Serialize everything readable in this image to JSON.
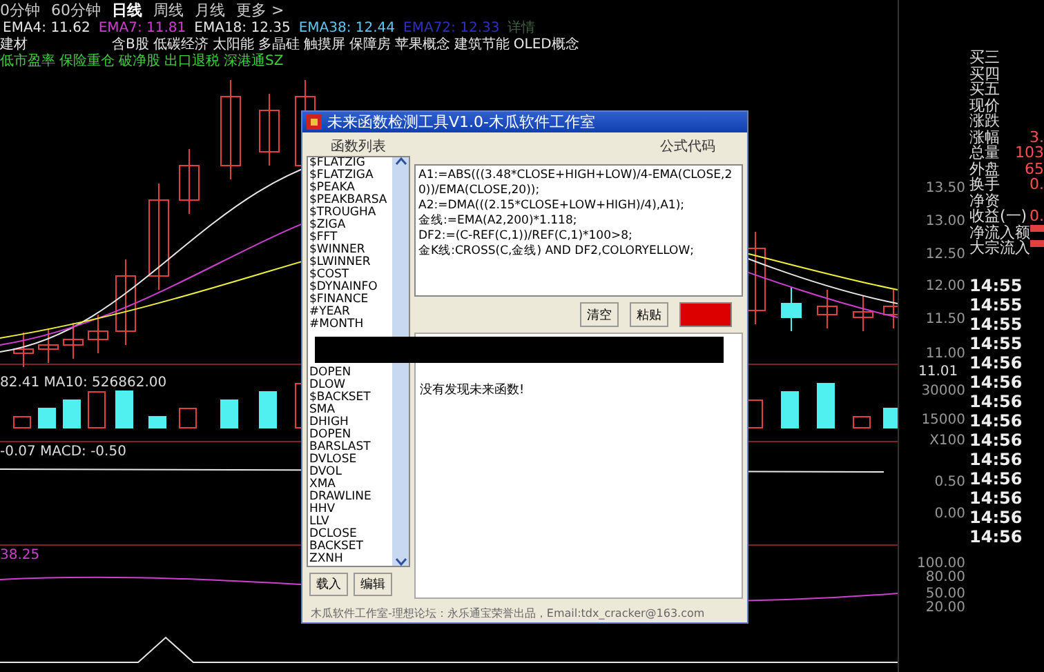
{
  "period_tabs": [
    {
      "label": "0分钟",
      "selected": false
    },
    {
      "label": "60分钟",
      "selected": false
    },
    {
      "label": "日线",
      "selected": true
    },
    {
      "label": "周线",
      "selected": false
    },
    {
      "label": "月线",
      "selected": false
    },
    {
      "label": "更多 >",
      "selected": false
    }
  ],
  "indicators": [
    {
      "text": "EMA4: 11.62",
      "color": "#e8e8e8"
    },
    {
      "text": "EMA7: 11.81",
      "color": "#d040d0"
    },
    {
      "text": "EMA18: 12.35",
      "color": "#e8e8e8"
    },
    {
      "text": "EMA38: 12.44",
      "color": "#60c8f0"
    },
    {
      "text": "EMA72: 12.33",
      "color": "#3030c0"
    },
    {
      "text": "详情",
      "color": "#406040"
    }
  ],
  "concepts_line_1": [
    "建材",
    "含B股",
    "低碳经济",
    "太阳能",
    "多晶硅",
    "触摸屏",
    "保障房",
    "苹果概念",
    "建筑节能",
    "OLED概念"
  ],
  "concepts_line_2": [
    "低市盈率",
    "保险重仓",
    "破净股",
    "出口退税",
    "深港通SZ"
  ],
  "chart_readouts": {
    "volume": "82.41 MA10: 526862.00",
    "macd": "-0.07 MACD: -0.50",
    "lower": "38.25",
    "price_marker": "11.01"
  },
  "axis_labels": [
    "13.50",
    "13.00",
    "12.50",
    "12.00",
    "11.50",
    "11.00",
    "30000",
    "15000",
    "X100",
    "0.50",
    "0.00",
    "100.00",
    "80.00",
    "50.00",
    "20.00"
  ],
  "quote_panel": [
    {
      "label": "买三"
    },
    {
      "label": "买四"
    },
    {
      "label": "买五"
    },
    {
      "label": "现价"
    },
    {
      "label": "涨跌"
    },
    {
      "label": "涨幅",
      "value": "3."
    },
    {
      "label": "总量",
      "value": "103"
    },
    {
      "label": "外盘",
      "value": "65"
    },
    {
      "label": "换手",
      "value": "0."
    },
    {
      "label": "净资"
    },
    {
      "label": "收益(一)",
      "value": "0."
    },
    {
      "label": "净流入额"
    },
    {
      "label": "大宗流入"
    }
  ],
  "trade_times": [
    "14:55",
    "14:55",
    "14:55",
    "14:55",
    "14:56",
    "14:56",
    "14:56",
    "14:56",
    "14:56",
    "14:56",
    "14:56",
    "14:56",
    "14:56",
    "14:56"
  ],
  "dialog": {
    "title": "未来函数检测工具V1.0-木瓜软件工作室",
    "list_heading": "函数列表",
    "code_heading": "公式代码",
    "functions_top": [
      "$FLATZIG",
      "$FLATZIGA",
      "$PEAKA",
      "$PEAKBARSA",
      "$TROUGHA",
      "$ZIGA",
      "$FFT",
      "$WINNER",
      "$LWINNER",
      "$COST",
      "$DYNAINFO",
      "$FINANCE",
      "#YEAR",
      "#MONTH"
    ],
    "functions_bottom": [
      "DOPEN",
      "DLOW",
      "$BACKSET",
      "SMA",
      "DHIGH",
      "DOPEN",
      "BARSLAST",
      "DVLOSE",
      "DVOL",
      "XMA",
      "DRAWLINE",
      "HHV",
      "LLV",
      "DCLOSE",
      "BACKSET",
      "ZXNH"
    ],
    "code_lines": [
      "A1:=ABS(((3.48*CLOSE+HIGH+LOW)/4-EMA(CLOSE,20))/EMA(CLOSE,20));",
      "A2:=DMA(((2.15*CLOSE+LOW+HIGH)/4),A1);",
      "金线:=EMA(A2,200)*1.118;",
      "DF2:=(C-REF(C,1))/REF(C,1)*100>8;",
      "金K线:CROSS(C,金线) AND DF2,COLORYELLOW;"
    ],
    "buttons": [
      "清空",
      "粘贴"
    ],
    "result": "没有发现未来函数!",
    "list_buttons": [
      "载入",
      "编辑"
    ],
    "footer": "木瓜软件工作室-理想论坛：永乐通宝荣誉出品，Email:tdx_cracker@163.com"
  }
}
